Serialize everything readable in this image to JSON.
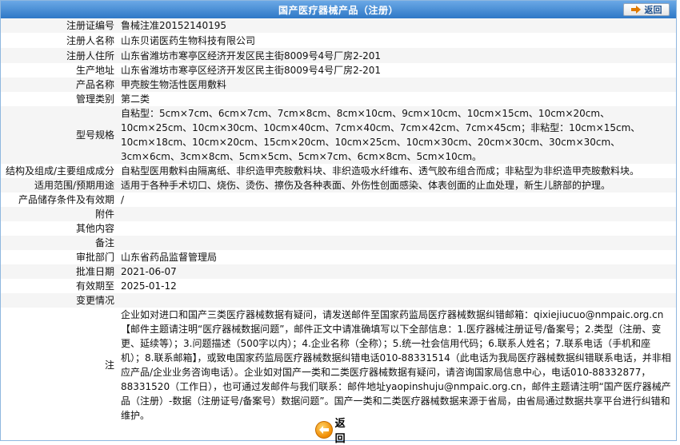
{
  "header": {
    "title": "国产医疗器械产品（注册）",
    "back_label": "返回"
  },
  "rows": [
    {
      "key": "注册证编号",
      "value": "鲁械注准20152140195"
    },
    {
      "key": "注册人名称",
      "value": "山东贝诺医药生物科技有限公司"
    },
    {
      "key": "注册人住所",
      "value": "山东省潍坊市寒亭区经济开发区民主街8009号4号厂房2-201"
    },
    {
      "key": "生产地址",
      "value": "山东省潍坊市寒亭区经济开发区民主街8009号4号厂房2-201"
    },
    {
      "key": "产品名称",
      "value": "甲壳胺生物活性医用敷料"
    },
    {
      "key": "管理类别",
      "value": "第二类"
    },
    {
      "key": "型号规格",
      "value": "自粘型：5cm×7cm、6cm×7cm、7cm×8cm、8cm×10cm、9cm×10cm、10cm×15cm、10cm×20cm、10cm×25cm、10cm×30cm、10cm×40cm、7cm×40cm、7cm×42cm、7cm×45cm；非粘型：10cm×15cm、10cm×18cm、10cm×20cm、15cm×20cm、10cm×25cm、10cm×30cm、20cm×30cm、30cm×30cm、3cm×6cm、3cm×8cm、5cm×5cm、5cm×7cm、6cm×8cm、5cm×10cm。"
    },
    {
      "key": "结构及组成/主要组成成分",
      "value": "自粘型医用敷料由隔离纸、非织造甲壳胺敷料块、非织造吸水纤维布、透气胶布组合而成；非粘型为非织造甲壳胺敷料块。"
    },
    {
      "key": "适用范围/预期用途",
      "value": "适用于各种手术切口、烧伤、烫伤、擦伤及各种表面、外伤性创面感染、体表创面的止血处理，新生儿脐部的护理。"
    },
    {
      "key": "产品储存条件及有效期",
      "value": "/"
    },
    {
      "key": "附件",
      "value": ""
    },
    {
      "key": "其他内容",
      "value": ""
    },
    {
      "key": "备注",
      "value": ""
    },
    {
      "key": "审批部门",
      "value": "山东省药品监督管理局"
    },
    {
      "key": "批准日期",
      "value": "2021-06-07"
    },
    {
      "key": "有效期至",
      "value": "2025-01-12"
    },
    {
      "key": "变更情况",
      "value": ""
    },
    {
      "key": "注",
      "value": "企业如对进口和国产三类医疗器械数据有疑问，请发送邮件至国家药监局医疗器械数据纠错邮箱：qixiejiucuo@nmpaic.org.cn【邮件主题请注明“医疗器械数据问题”，邮件正文中请准确填写以下全部信息：1.医疗器械注册证号/备案号；2.类型（注册、变更、延续等）；3.问题描述（500字以内）；4.企业名称（全称）；5.统一社会信用代码；6.联系人姓名；7.联系电话（手机和座机）；8.联系邮箱】，或致电国家药监局医疗器械数据纠错电话010-88331514（此电话为我局医疗器械数据纠错联系电话，并非相应产品/企业业务咨询电话）。企业如对国产一类和二类医疗器械数据有疑问，请咨询国家局信息中心，电话010-88332877，88331520（工作日），也可通过发邮件与我们联系：邮件地址yaopinshuju@nmpaic.org.cn，邮件主题请注明“国产医疗器械产品（注册）-数据（注册证号/备案号）数据问题”。国产一类和二类医疗器械数据来源于省局，由省局通过数据共享平台进行纠错和维护。"
    }
  ]
}
